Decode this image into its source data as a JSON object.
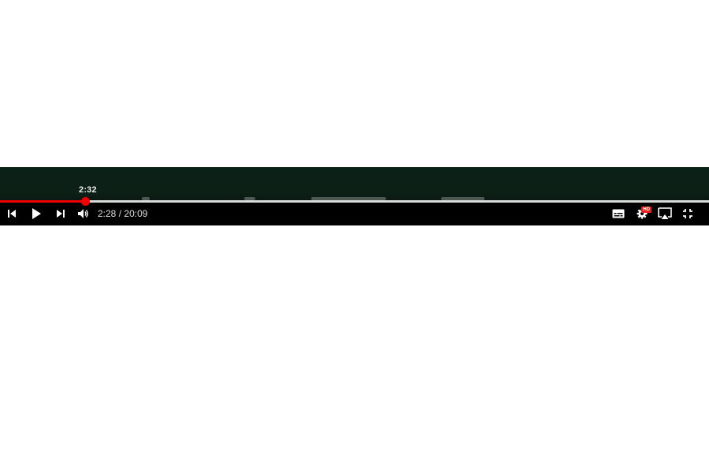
{
  "player": {
    "hover_time": "2:32",
    "current_time": "2:28",
    "time_separator": "/",
    "duration": "20:09",
    "progress_fraction": 0.12,
    "progress_color": "#f00000",
    "settings_badge": "HD"
  },
  "controls": {
    "left": [
      "previous-icon",
      "play-icon",
      "next-icon",
      "volume-icon"
    ],
    "right": [
      "subtitles-icon",
      "settings-icon",
      "airplay-icon",
      "exit-fullscreen-icon"
    ]
  }
}
